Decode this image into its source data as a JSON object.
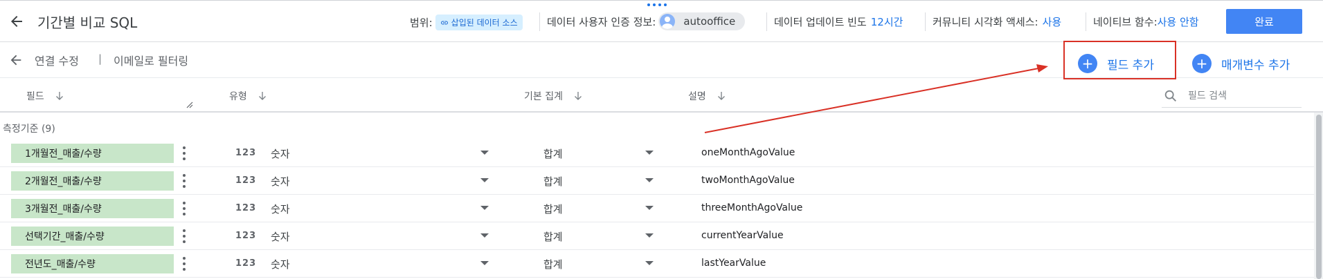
{
  "header": {
    "title": "기간별 비교 SQL",
    "scope_label": "범위:",
    "scope_chip": "삽입된 데이터 소스",
    "credentials_label": "데이터 사용자 인증 정보:",
    "credentials_user": "autooffice",
    "freshness_label": "데이터 업데이트 빈도",
    "freshness_value": "12시간",
    "community_label": "커뮤니티 시각화 액세스:",
    "community_value": "사용",
    "native_label": "네이티브 함수:",
    "native_value": "사용 안함",
    "done_label": "완료"
  },
  "subbar": {
    "edit_connection": "연결 수정",
    "divider": "|",
    "filter_by_email": "이메일로 필터링",
    "add_field": "필드 추가",
    "add_parameter": "매개변수 추가"
  },
  "columns": {
    "field": "필드",
    "type": "유형",
    "aggregation": "기본 집계",
    "description": "설명"
  },
  "search": {
    "placeholder": "필드 검색"
  },
  "section": {
    "title": "측정기준 (9)"
  },
  "rows": [
    {
      "name": "1개월전_매출/수량",
      "type_icon": "123",
      "type": "숫자",
      "aggregation": "합계",
      "description": "oneMonthAgoValue"
    },
    {
      "name": "2개월전_매출/수량",
      "type_icon": "123",
      "type": "숫자",
      "aggregation": "합계",
      "description": "twoMonthAgoValue"
    },
    {
      "name": "3개월전_매출/수량",
      "type_icon": "123",
      "type": "숫자",
      "aggregation": "합계",
      "description": "threeMonthAgoValue"
    },
    {
      "name": "선택기간_매출/수량",
      "type_icon": "123",
      "type": "숫자",
      "aggregation": "합계",
      "description": "currentYearValue"
    },
    {
      "name": "전년도_매출/수량",
      "type_icon": "123",
      "type": "숫자",
      "aggregation": "합계",
      "description": "lastYearValue"
    }
  ],
  "colors": {
    "accent": "#1a73e8",
    "primary_button": "#4285f4",
    "field_chip": "#c8e6c9",
    "annotation": "#d93025"
  },
  "icons": {
    "back": "back-arrow-icon",
    "link": "link-icon",
    "avatar": "user-avatar-icon",
    "sort": "arrow-down-icon",
    "search": "search-icon",
    "plus": "plus-icon",
    "more": "kebab-menu-icon",
    "dropdown": "caret-down-icon"
  }
}
